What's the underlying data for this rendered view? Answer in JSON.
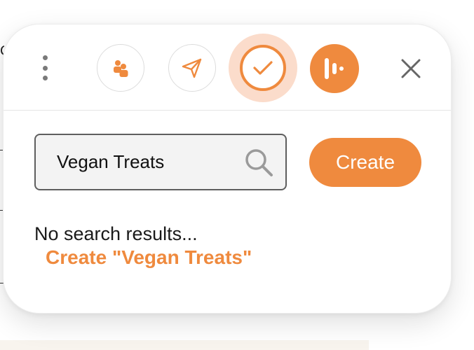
{
  "toolbar": {
    "more_icon": "kebab-vertical-icon",
    "buttons": [
      {
        "icon": "users-icon",
        "state": "default"
      },
      {
        "icon": "send-icon",
        "state": "default"
      },
      {
        "icon": "check-icon",
        "state": "active"
      },
      {
        "icon": "app-logo-icon",
        "state": "filled"
      }
    ],
    "close_icon": "close-icon"
  },
  "search": {
    "value": "Vegan Treats",
    "icon": "search-icon"
  },
  "create_button": {
    "label": "Create"
  },
  "results": {
    "empty_message": "No search results...",
    "create_link": "Create \"Vegan Treats\""
  },
  "colors": {
    "accent": "#ef8a3e",
    "accent_halo": "#fbdccb",
    "border": "#5e5e5e",
    "icon_gray": "#7a7a7a"
  }
}
